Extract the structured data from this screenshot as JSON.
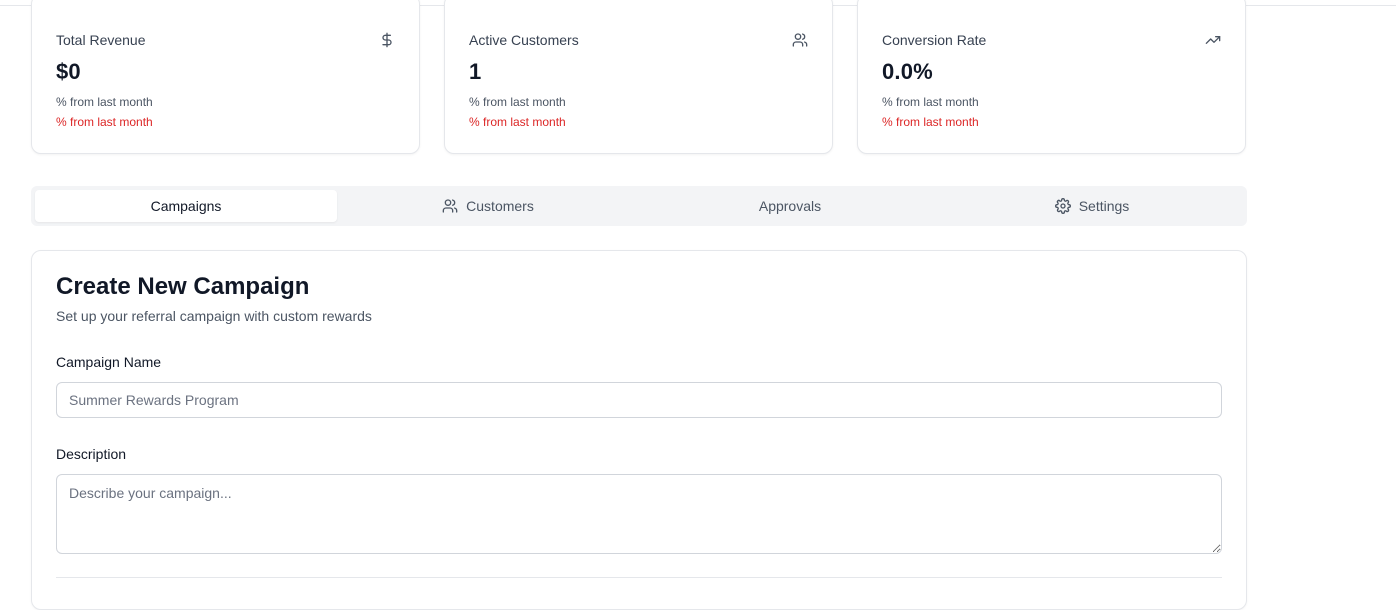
{
  "stats": [
    {
      "label": "Total Revenue",
      "value": "$0",
      "sub1": "% from last month",
      "sub2": "% from last month",
      "icon": "dollar-icon"
    },
    {
      "label": "Active Customers",
      "value": "1",
      "sub1": "% from last month",
      "sub2": "% from last month",
      "icon": "users-icon"
    },
    {
      "label": "Conversion Rate",
      "value": "0.0%",
      "sub1": "% from last month",
      "sub2": "% from last month",
      "icon": "trending-up-icon"
    }
  ],
  "tabs": [
    {
      "label": "Campaigns",
      "icon": null,
      "active": true
    },
    {
      "label": "Customers",
      "icon": "users-icon",
      "active": false
    },
    {
      "label": "Approvals",
      "icon": null,
      "active": false
    },
    {
      "label": "Settings",
      "icon": "gear-icon",
      "active": false
    }
  ],
  "form": {
    "title": "Create New Campaign",
    "subtitle": "Set up your referral campaign with custom rewards",
    "campaign_name_label": "Campaign Name",
    "campaign_name_placeholder": "Summer Rewards Program",
    "description_label": "Description",
    "description_placeholder": "Describe your campaign..."
  },
  "colors": {
    "negative": "#dc2626",
    "border": "#e5e7eb",
    "tab_bg": "#f3f4f6"
  }
}
